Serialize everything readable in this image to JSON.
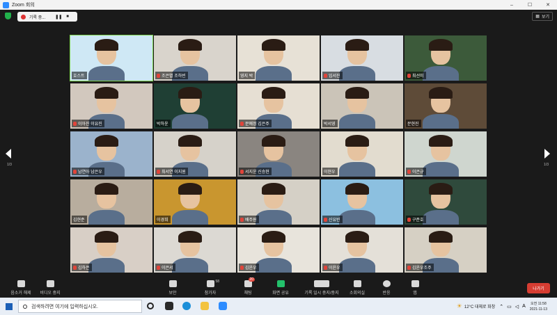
{
  "window": {
    "title": "Zoom 회의",
    "minimize": "–",
    "maximize": "☐",
    "close": "✕"
  },
  "recording": {
    "text": "기록 중...",
    "pause": "❚❚",
    "stop": "■"
  },
  "view_label": "보기",
  "pagination": {
    "left": "1/3",
    "right": "1/3"
  },
  "participants": [
    {
      "name": "호스트",
      "muted": false,
      "bg": "#cfe8f5"
    },
    {
      "name": "조은별 조하빈",
      "muted": true,
      "bg": "#d9d4cc"
    },
    {
      "name": "영지 박",
      "muted": false,
      "bg": "#e7e1d6"
    },
    {
      "name": "임서진",
      "muted": true,
      "bg": "#d8dde2"
    },
    {
      "name": "최선미",
      "muted": true,
      "bg": "#3c5a3a"
    },
    {
      "name": "이아진 이유진",
      "muted": true,
      "bg": "#d2c8be"
    },
    {
      "name": "박하윤",
      "muted": false,
      "bg": "#1f3f34"
    },
    {
      "name": "문예정 김은주",
      "muted": true,
      "bg": "#e6dfd3"
    },
    {
      "name": "박서영",
      "muted": false,
      "bg": "#cbc4b8"
    },
    {
      "name": "문현진",
      "muted": false,
      "bg": "#5e4b38"
    },
    {
      "name": "남연아 남은우",
      "muted": true,
      "bg": "#9bb3cc"
    },
    {
      "name": "최서연 이지원",
      "muted": true,
      "bg": "#d6d2ca"
    },
    {
      "name": "서지윤 신승현",
      "muted": true,
      "bg": "#8a8580"
    },
    {
      "name": "이현우",
      "muted": false,
      "bg": "#e2dccf"
    },
    {
      "name": "이은규",
      "muted": true,
      "bg": "#cfd6cf"
    },
    {
      "name": "김현준",
      "muted": false,
      "bg": "#b8ad9e"
    },
    {
      "name": "이경희",
      "muted": false,
      "bg": "#c9962f"
    },
    {
      "name": "배주원",
      "muted": true,
      "bg": "#d5d0c6"
    },
    {
      "name": "신유빈",
      "muted": true,
      "bg": "#8cc0e0"
    },
    {
      "name": "구준호",
      "muted": true,
      "bg": "#2f4a3c"
    },
    {
      "name": "김하은",
      "muted": true,
      "bg": "#d8cfc6"
    },
    {
      "name": "이은서",
      "muted": true,
      "bg": "#dcd9d3"
    },
    {
      "name": "김윤우",
      "muted": true,
      "bg": "#e8e4dc"
    },
    {
      "name": "이윤우",
      "muted": true,
      "bg": "#e4e0d8"
    },
    {
      "name": "김윤우조주",
      "muted": true,
      "bg": "#d6d0c4"
    }
  ],
  "toolbar": {
    "mute": "음소거 해제",
    "video": "비디오 중지",
    "security": "보안",
    "participants": "참가자",
    "participants_count": "58",
    "chat": "채팅",
    "chat_badge": "20",
    "share": "화면 공유",
    "record": "기록 일시 중지/중지",
    "rooms": "소회의실",
    "reactions": "반응",
    "apps": "앱",
    "leave": "나가기"
  },
  "taskbar": {
    "search_placeholder": "검색하려면 여기에 입력하십시오.",
    "weather": "12°C  대체로 화창",
    "lang": "A",
    "time_ampm": "오전 11:58",
    "date": "2021-11-13"
  }
}
